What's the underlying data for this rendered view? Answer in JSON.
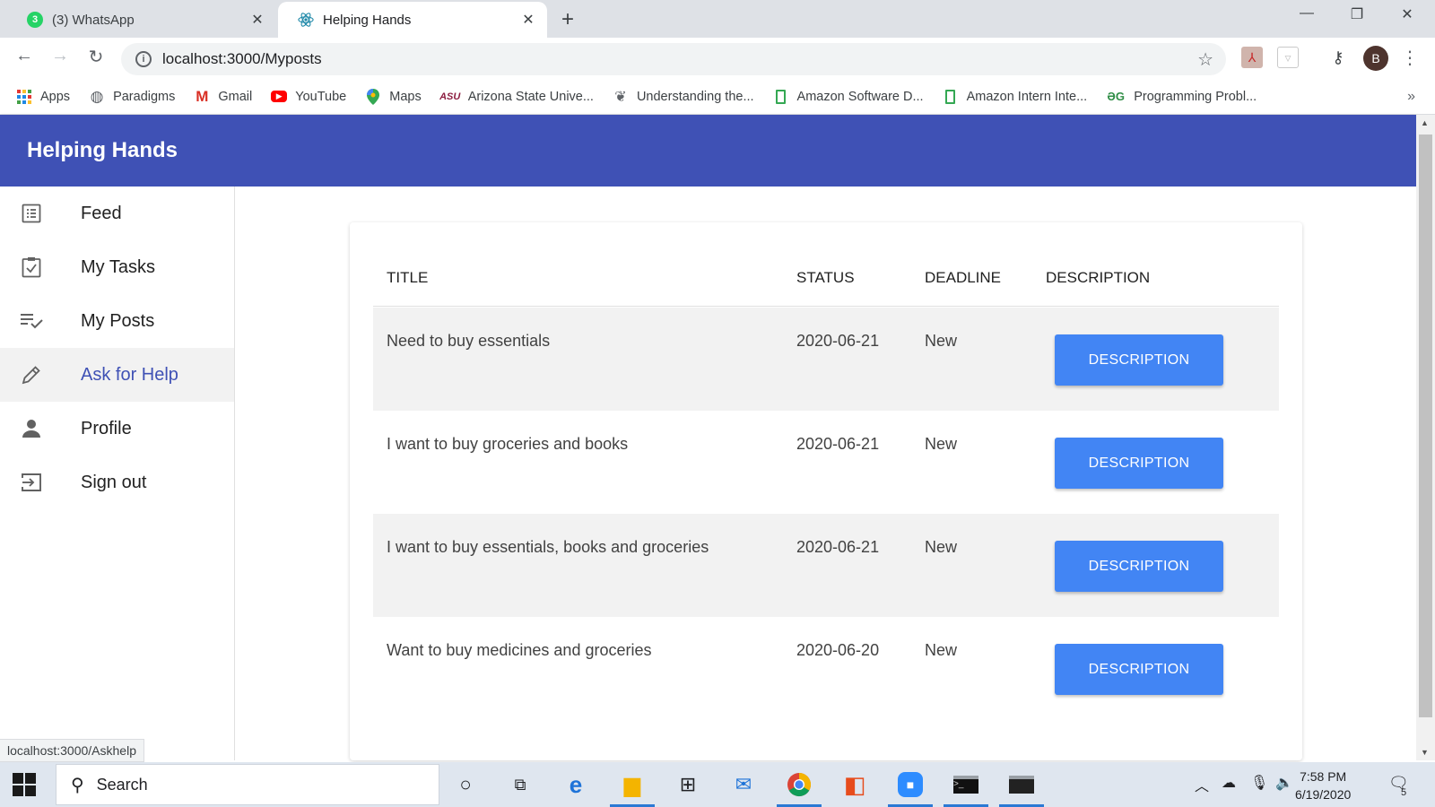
{
  "browser": {
    "tabs": [
      {
        "title": "(3) WhatsApp",
        "badge": "3",
        "color": "#25d366"
      },
      {
        "title": "Helping Hands",
        "icon": "react-icon"
      }
    ],
    "close_glyph": "✕",
    "new_tab_glyph": "+",
    "url": "localhost:3000/Myposts",
    "bookmarks": [
      {
        "label": "Apps",
        "icon": "apps-grid-icon"
      },
      {
        "label": "Paradigms",
        "icon": "globe-icon"
      },
      {
        "label": "Gmail",
        "icon": "gmail-icon"
      },
      {
        "label": "YouTube",
        "icon": "youtube-icon"
      },
      {
        "label": "Maps",
        "icon": "maps-pin-icon"
      },
      {
        "label": "Arizona State Unive...",
        "icon": "asu-icon"
      },
      {
        "label": "Understanding the...",
        "icon": "page-icon"
      },
      {
        "label": "Amazon Software D...",
        "icon": "bookmark-page-icon"
      },
      {
        "label": "Amazon Intern Inte...",
        "icon": "bookmark-page-icon"
      },
      {
        "label": "Programming Probl...",
        "icon": "gfg-icon"
      }
    ],
    "avatar_letter": "B",
    "status_url": "localhost:3000/Askhelp"
  },
  "app": {
    "title": "Helping Hands",
    "nav": [
      {
        "label": "Feed",
        "icon": "feed-list-icon"
      },
      {
        "label": "My Tasks",
        "icon": "task-check-icon"
      },
      {
        "label": "My Posts",
        "icon": "playlist-check-icon"
      },
      {
        "label": "Ask for Help",
        "icon": "pencil-icon",
        "selected": true
      },
      {
        "label": "Profile",
        "icon": "person-icon"
      },
      {
        "label": "Sign out",
        "icon": "sign-out-icon"
      }
    ],
    "table": {
      "headers": {
        "title": "TITLE",
        "status": "STATUS",
        "deadline": "DEADLINE",
        "description": "DESCRIPTION"
      },
      "rows": [
        {
          "title": "Need to buy essentials",
          "status": "2020-06-21",
          "deadline": "New",
          "button": "DESCRIPTION"
        },
        {
          "title": "I want to buy groceries and books",
          "status": "2020-06-21",
          "deadline": "New",
          "button": "DESCRIPTION"
        },
        {
          "title": "I want to buy essentials, books and groceries",
          "status": "2020-06-21",
          "deadline": "New",
          "button": "DESCRIPTION"
        },
        {
          "title": "Want to buy medicines and groceries",
          "status": "2020-06-20",
          "deadline": "New",
          "button": "DESCRIPTION"
        }
      ]
    },
    "colors": {
      "primary": "#3f51b5",
      "button": "#4285f4",
      "row_shade": "#f2f2f2"
    }
  },
  "taskbar": {
    "search_placeholder": "Search",
    "time": "7:58 PM",
    "date": "6/19/2020",
    "notification_count": "5"
  }
}
